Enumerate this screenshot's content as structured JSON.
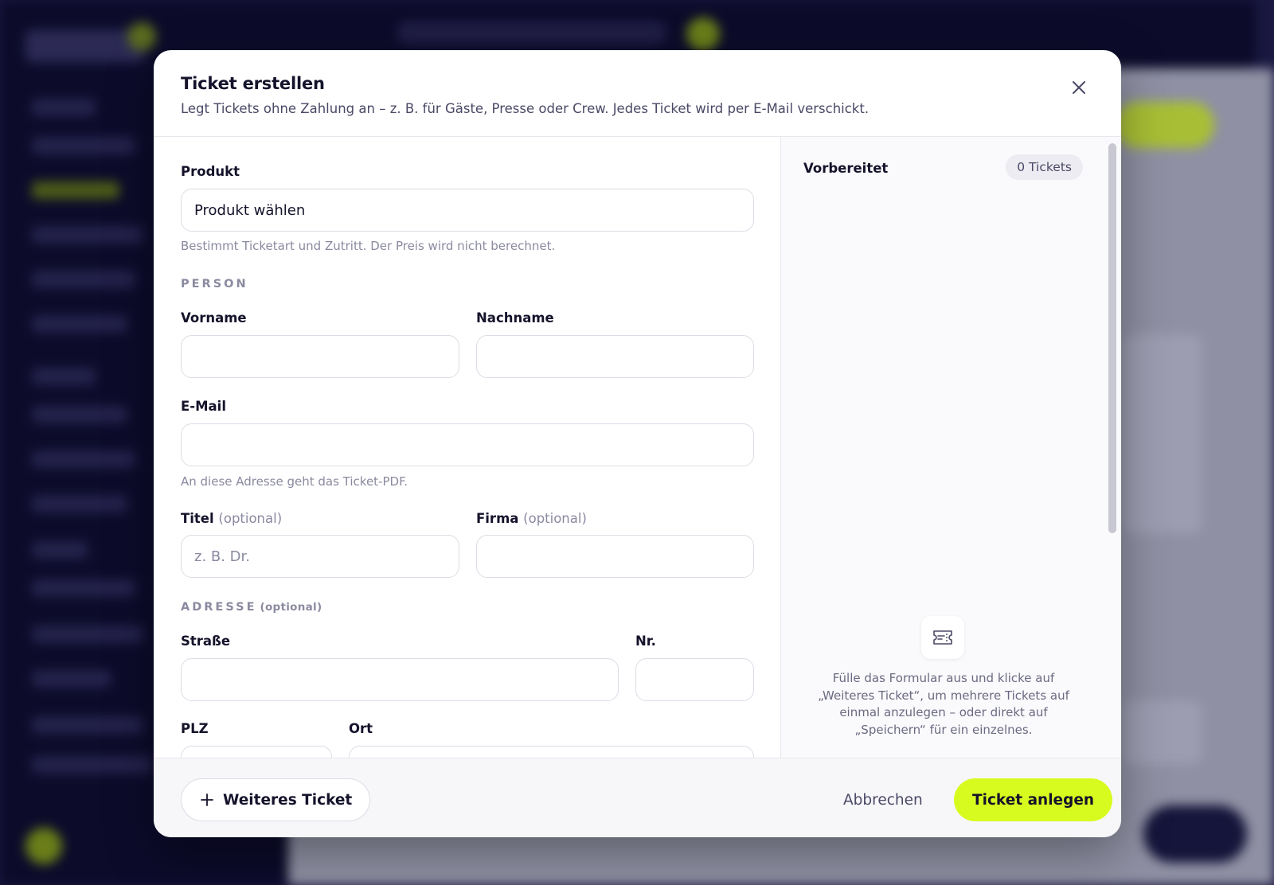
{
  "modal": {
    "title": "Ticket erstellen",
    "subtitle": "Legt Tickets ohne Zahlung an – z. B. für Gäste, Presse oder Crew. Jedes Ticket wird per E-Mail verschickt."
  },
  "form": {
    "product": {
      "label": "Produkt",
      "value": "Produkt wählen",
      "hint": "Bestimmt Ticketart und Zutritt. Der Preis wird nicht berechnet."
    },
    "person_section": "PERSON",
    "firstname": {
      "label": "Vorname",
      "value": ""
    },
    "lastname": {
      "label": "Nachname",
      "value": ""
    },
    "email": {
      "label": "E-Mail",
      "value": "",
      "hint": "An diese Adresse geht das Ticket-PDF."
    },
    "title_field": {
      "label": "Titel",
      "optional": "(optional)",
      "placeholder": "z. B. Dr.",
      "value": ""
    },
    "company": {
      "label": "Firma",
      "optional": "(optional)",
      "value": ""
    },
    "address_section": {
      "label": "ADRESSE",
      "optional": "(optional)"
    },
    "street": {
      "label": "Straße",
      "value": ""
    },
    "number": {
      "label": "Nr.",
      "value": ""
    },
    "zip": {
      "label": "PLZ",
      "value": ""
    },
    "city": {
      "label": "Ort",
      "value": ""
    }
  },
  "side_panel": {
    "title": "Vorbereitet",
    "count_badge": "0 Tickets",
    "icon": "ticket-icon",
    "empty_text": "Fülle das Formular aus und klicke auf „Weiteres Ticket“, um mehrere Tickets auf einmal anzulegen – oder direkt auf „Speichern“ für ein einzelnes."
  },
  "footer": {
    "add_label": "Weiteres Ticket",
    "cancel_label": "Abbrechen",
    "submit_label": "Ticket anlegen"
  },
  "colors": {
    "accent": "#d8fb1f",
    "text": "#14132b",
    "muted": "#8a8aa0"
  }
}
